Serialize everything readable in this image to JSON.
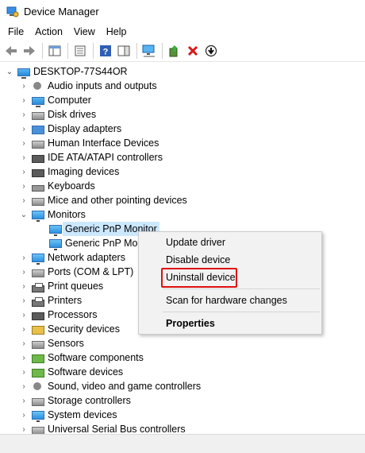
{
  "window": {
    "title": "Device Manager"
  },
  "menu": [
    "File",
    "Action",
    "View",
    "Help"
  ],
  "toolbar": {
    "buttons": [
      "back-icon",
      "forward-icon",
      "show-hide-tree-icon",
      "properties-icon",
      "help-icon",
      "action-pane-icon",
      "scan-hardware-icon",
      "update-driver-icon",
      "uninstall-icon",
      "disable-icon"
    ]
  },
  "tree": {
    "root": "DESKTOP-77S44OR",
    "items": [
      "Audio inputs and outputs",
      "Computer",
      "Disk drives",
      "Display adapters",
      "Human Interface Devices",
      "IDE ATA/ATAPI controllers",
      "Imaging devices",
      "Keyboards",
      "Mice and other pointing devices",
      "Monitors",
      "Generic PnP Monitor",
      "Generic PnP Monitor",
      "Network adapters",
      "Ports (COM & LPT)",
      "Print queues",
      "Printers",
      "Processors",
      "Security devices",
      "Sensors",
      "Software components",
      "Software devices",
      "Sound, video and game controllers",
      "Storage controllers",
      "System devices",
      "Universal Serial Bus controllers"
    ]
  },
  "context_menu": {
    "update": "Update driver",
    "disable": "Disable device",
    "uninstall": "Uninstall device",
    "scan": "Scan for hardware changes",
    "properties": "Properties"
  },
  "colors": {
    "highlight": "#e01010",
    "selection": "#cce8ff"
  }
}
